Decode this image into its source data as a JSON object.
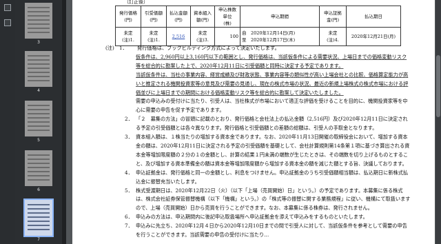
{
  "thumbnails": [
    {
      "num": "3",
      "selected": false
    },
    {
      "num": "4",
      "selected": false
    },
    {
      "num": "5",
      "selected": false
    },
    {
      "num": "6",
      "selected": false
    },
    {
      "num": "7",
      "selected": true
    }
  ],
  "page": {
    "header_label": "（訂正後）",
    "table": {
      "headers": [
        "発行価格\n(円)",
        "引受価額\n(円)",
        "払込金額\n(円)",
        "資本組入\n額(円)",
        "申込株数\n単位\n(株)",
        "申込期間",
        "申込証拠\n金(円)",
        "払込期日"
      ],
      "row": {
        "issue_price": "未定\n(注)1.",
        "underwriting_price": "未定\n(注)1.",
        "paid_amount": "2,516",
        "capital": "未定\n(注)3.",
        "unit": "100",
        "period_from": "自　2020年12月14日(月)",
        "period_to": "至　2020年12月17日(木)",
        "deposit": "未定\n(注)4.",
        "payment_date": "2020年12月21日(月)"
      }
    },
    "notes": [
      {
        "mark": "(注)　1．",
        "text": "発行価格は、ブックビルディング方式によって決定いたします。"
      },
      {
        "mark": "",
        "text": "仮条件は、2,960円以上3,160円以下の範囲とし、発行価格は、当該仮条件による需要状況、上場日までの価格変動リスク等を総合的に勘案した上で、2020年12月11日に引受価額と同時に決定する予定であります。"
      },
      {
        "mark": "",
        "text": "当該仮条件は、当社の事業内容、経営成績及び財政状態、事業内容等の類似性が高い上場会社との比較、価格算定能力が高いと推定される機関投資家等の意見及び需要の見通し、現在の株式市場の状況、最近の新規上場株式の株式市場における評価並びに上場日までの期間における価格変動リスク等を総合的に勘案して決定いたしました。"
      },
      {
        "mark": "",
        "text": "需要の申込みの受付けに当たり、引受人は、当社株式が市場において適正な評価を受けることを目的に、機関投資家等を中心に需要の申告を促す予定であります。"
      },
      {
        "mark": "2．",
        "text": "「２　募集の方法」の冒頭に記載のとおり、発行価格と会社法上の払込金額（2,516円）及び2020年12月11日に決定される予定の引受価額とは各々異なります。発行価格と引受価額との差額の総額は、引受人の手取金となります。"
      },
      {
        "mark": "3．",
        "text": "資本組入額は、１株当たりの増加する資本金であります。なお、2020年11月13日開催の取締役会において、増加する資本金の額は、2020年12月11日に決定される予定の引受価額を基礎として、会社計算規則第14条第１項に基づき算出される資本金等増加限度額の２分の１の金額とし、計算の結果１円未満の端数が生じたときは、その端数を切り上げるものとすること、及び増加する資本準備金の額は資本金等増加限度額から増加する資本金の額を減じた額とする旨、決議しております。"
      },
      {
        "mark": "4．",
        "text": "申込証拠金は、発行価格と同一の金額とし、利息をつけません。申込証拠金のうち引受価額相当額は、払込期日に新株式払込金に振替充当いたします。"
      },
      {
        "mark": "5．",
        "text": "株式受渡期日は、2020年12月22日（火）（以下「上場（売買開始）日」という。）の予定であります。本募集に係る株式は、株式会社証券保管振替機構（以下「機構」という。）の「株式等の振替に関する業務規程」に従い、機構にて取扱いますので、上場（売買開始）日から売買を行うことができます。なお、本募集に係る株券は、発行されません。"
      },
      {
        "mark": "6．",
        "text": "申込みの方法は、申込期間内に後記申込取扱場所へ申込証拠金を添えて申込みをするものといたします。"
      },
      {
        "mark": "7．",
        "text": "申込みに先立ち、2020年12月４日から2020年12月10日までの間で引受人に対して、当該仮条件を参考として需要の申告を行うことができます。当該需要の申告の受付けに当たり…"
      }
    ]
  }
}
